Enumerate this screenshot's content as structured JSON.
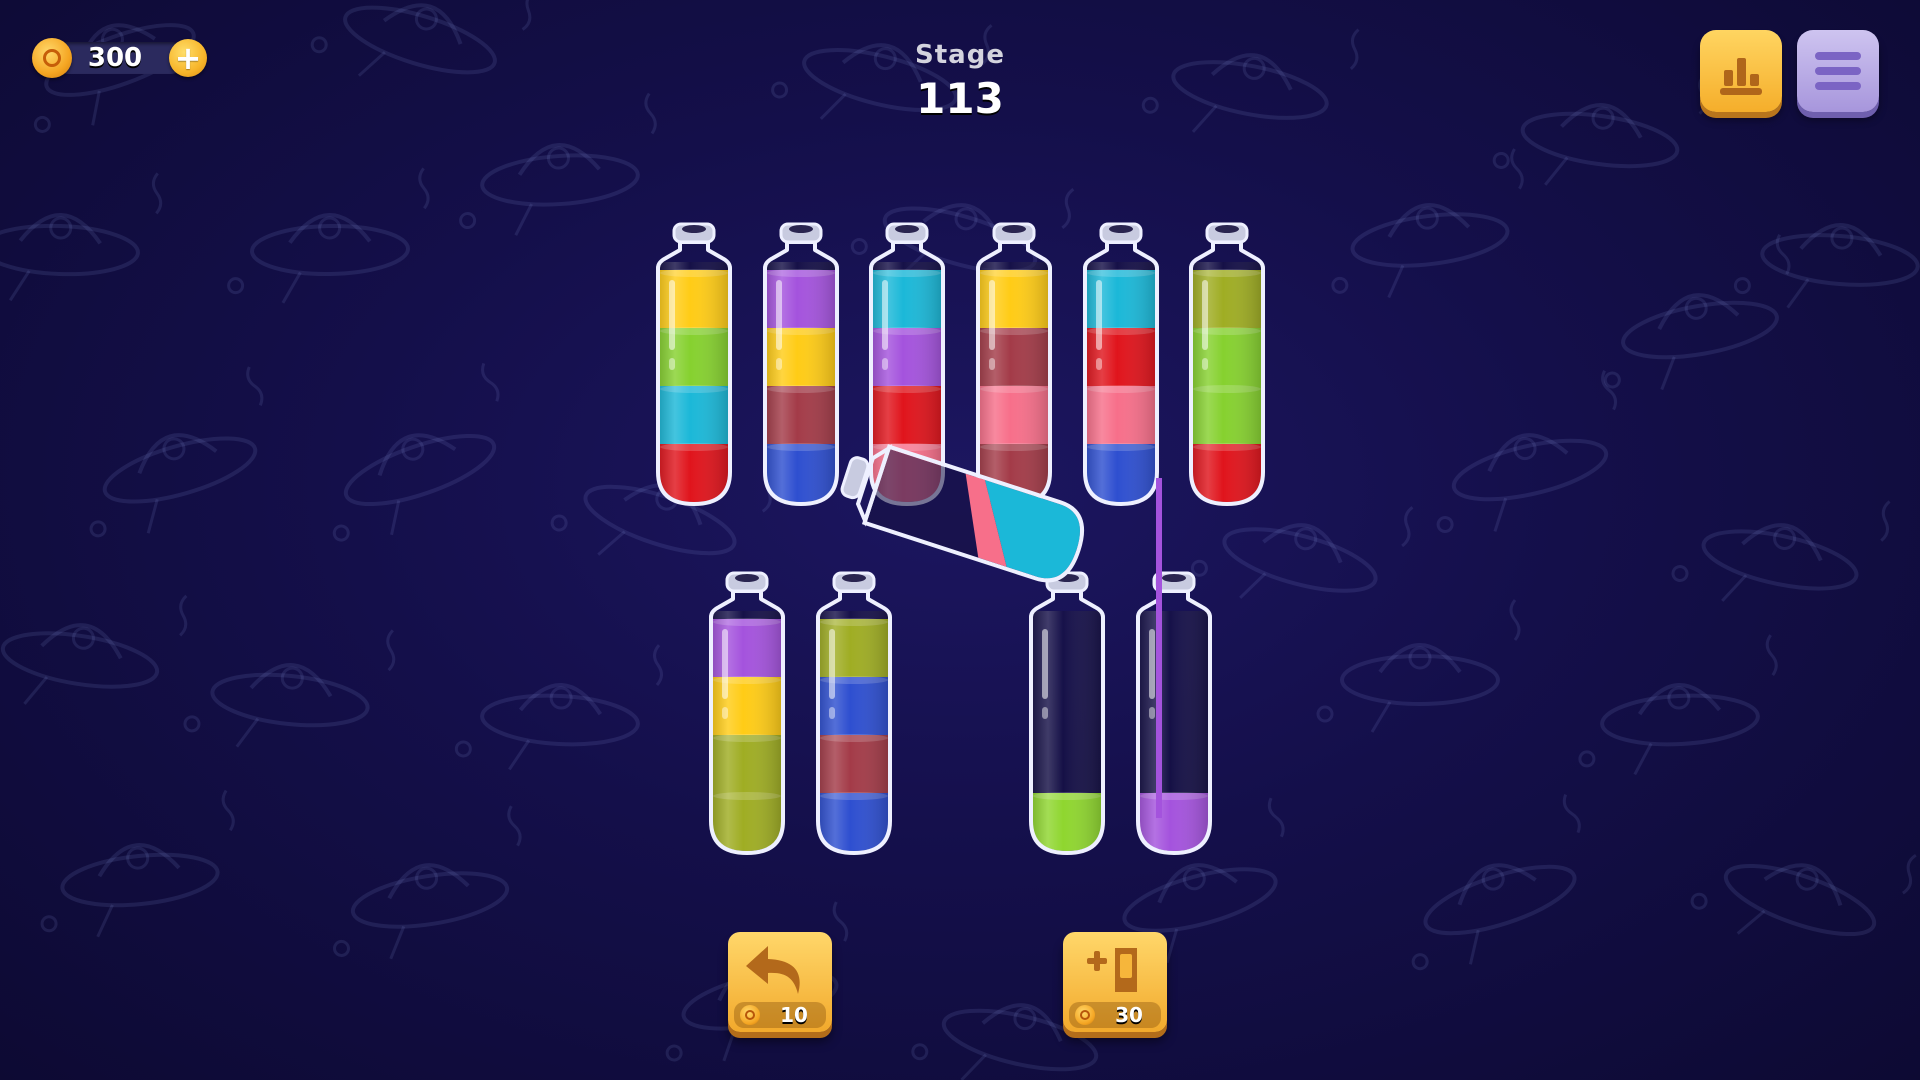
{
  "hud": {
    "coins": "300",
    "stage_label": "Stage",
    "stage_number": "113"
  },
  "buttons": {
    "undo_cost": "10",
    "add_tube_cost": "30"
  },
  "icons": {
    "coin": "coin-icon",
    "add_coins": "plus-icon",
    "leaderboard": "bar-chart-icon",
    "menu": "hamburger-menu-icon",
    "undo": "undo-arrow-icon",
    "add_tube": "add-tube-icon"
  },
  "colors": {
    "yellow": "#ffcc16",
    "green": "#86d12f",
    "cyan": "#1bb8d8",
    "red": "#e0141c",
    "purple": "#a453dd",
    "maroon": "#a33b48",
    "blue": "#2e4fd0",
    "pink": "#f76f8a",
    "olive": "#9fad23",
    "lime": "#8fd62f"
  },
  "tubes": {
    "capacity": 4,
    "top_row": [
      [
        "yellow",
        "green",
        "cyan",
        "red"
      ],
      [
        "purple",
        "yellow",
        "maroon",
        "blue"
      ],
      [
        "cyan",
        "purple",
        "red",
        "pink"
      ],
      [
        "yellow",
        "maroon",
        "pink",
        "maroon"
      ],
      [
        "cyan",
        "red",
        "pink",
        "blue"
      ],
      [
        "olive",
        "green",
        "green",
        "red"
      ]
    ],
    "bottom_row": [
      [
        "purple",
        "yellow",
        "olive",
        "olive"
      ],
      [
        "olive",
        "blue",
        "maroon",
        "blue"
      ],
      [
        null,
        null,
        null,
        "lime"
      ],
      [
        null,
        null,
        null,
        "purple"
      ]
    ],
    "pouring_tube": {
      "colors_from_bottom": [
        "cyan",
        "pink"
      ],
      "pouring_color": "purple"
    }
  }
}
